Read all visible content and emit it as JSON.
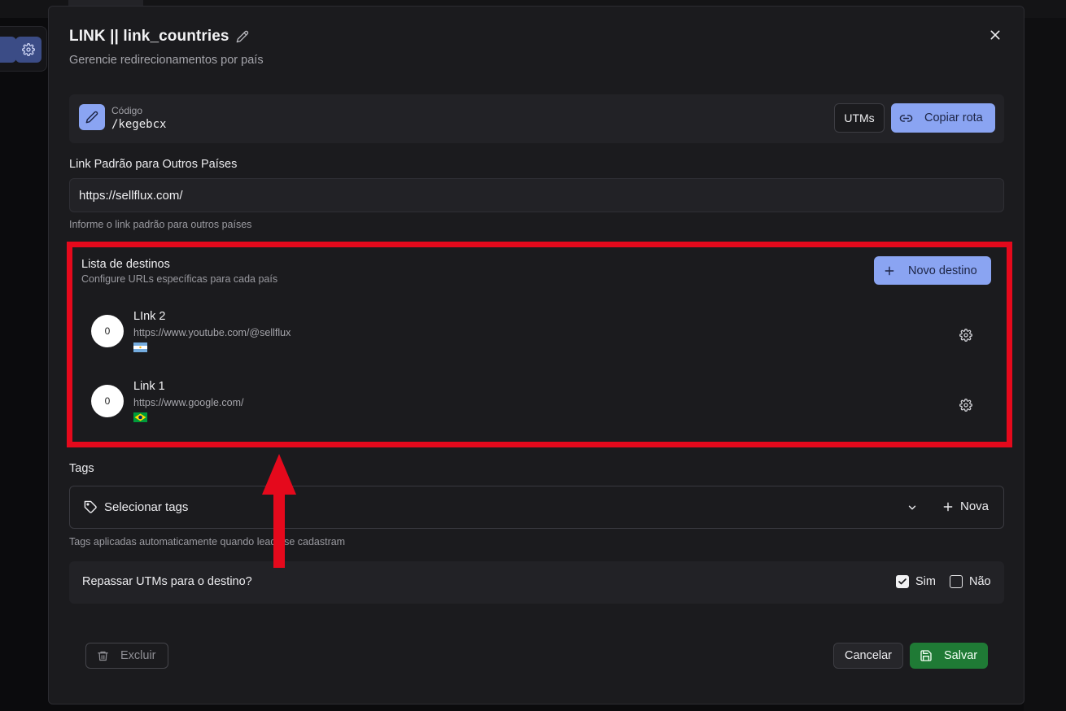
{
  "modal": {
    "title": "LINK || link_countries",
    "subtitle": "Gerencie redirecionamentos por país",
    "code_label": "Código",
    "code_value": "/kegebcx",
    "utms_label": "UTMs",
    "copy_route_label": "Copiar rota",
    "default_link_label": "Link Padrão para Outros Países",
    "default_link_value": "https://sellflux.com/",
    "default_link_hint": "Informe o link padrão para outros países",
    "destinations": {
      "title": "Lista de destinos",
      "subtitle": "Configure URLs específicas para cada país",
      "new_label": "Novo destino",
      "items": [
        {
          "count": "0",
          "name": "LInk 2",
          "url": "https://www.youtube.com/@sellflux",
          "flag": "argentina-flag"
        },
        {
          "count": "0",
          "name": "Link 1",
          "url": "https://www.google.com/",
          "flag": "brazil-flag"
        }
      ]
    },
    "tags": {
      "label": "Tags",
      "placeholder": "Selecionar tags",
      "new_label": "Nova",
      "hint": "Tags aplicadas automaticamente quando leads se cadastram"
    },
    "utm_pass": {
      "label": "Repassar UTMs para o destino?",
      "yes_label": "Sim",
      "no_label": "Não",
      "yes_checked": true,
      "no_checked": false
    },
    "footer": {
      "delete_label": "Excluir",
      "cancel_label": "Cancelar",
      "save_label": "Salvar"
    }
  },
  "colors": {
    "accent": "#8aa4f2",
    "save": "#1f7a35",
    "highlight": "#e5091c"
  }
}
